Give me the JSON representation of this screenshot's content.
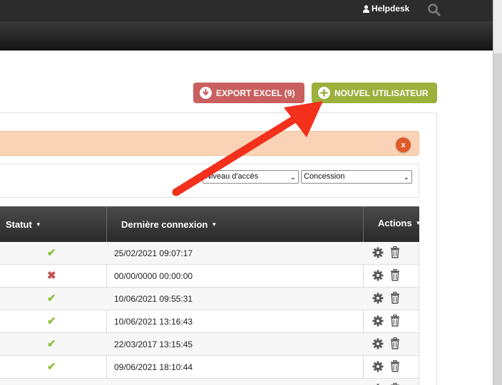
{
  "header": {
    "user_label": "Helpdesk",
    "user_icon": "user-icon",
    "search_icon": "search-icon"
  },
  "toolbar": {
    "export_label": "EXPORT EXCEL (9)",
    "new_user_label": "NOUVEL UTILISATEUR"
  },
  "alert": {
    "close_label": "x"
  },
  "filters": {
    "niveau_value": "Niveau d'accès",
    "concession_value": "Concession"
  },
  "table": {
    "columns": {
      "statut": "Statut",
      "derniere_connexion": "Dernière connexion",
      "actions": "Actions"
    },
    "rows": [
      {
        "status": "active",
        "status_glyph": "✔",
        "last_login": "25/02/2021 09:07:17"
      },
      {
        "status": "inactive",
        "status_glyph": "✖",
        "last_login": "00/00/0000 00:00:00"
      },
      {
        "status": "active",
        "status_glyph": "✔",
        "last_login": "10/06/2021 09:55:31"
      },
      {
        "status": "active",
        "status_glyph": "✔",
        "last_login": "10/06/2021 13:16:43"
      },
      {
        "status": "active",
        "status_glyph": "✔",
        "last_login": "22/03/2017 13:15:45"
      },
      {
        "status": "active",
        "status_glyph": "✔",
        "last_login": "09/06/2021 18:10:44"
      },
      {
        "status": "active",
        "status_glyph": "✔",
        "last_login": ""
      }
    ]
  },
  "colors": {
    "export_button": "#c9605f",
    "new_user_button": "#9bb13c",
    "alert_bg": "#fad3b6",
    "status_ok": "#8dbf3a",
    "status_ko": "#c74d4d",
    "annotation_arrow": "#f2301c"
  }
}
